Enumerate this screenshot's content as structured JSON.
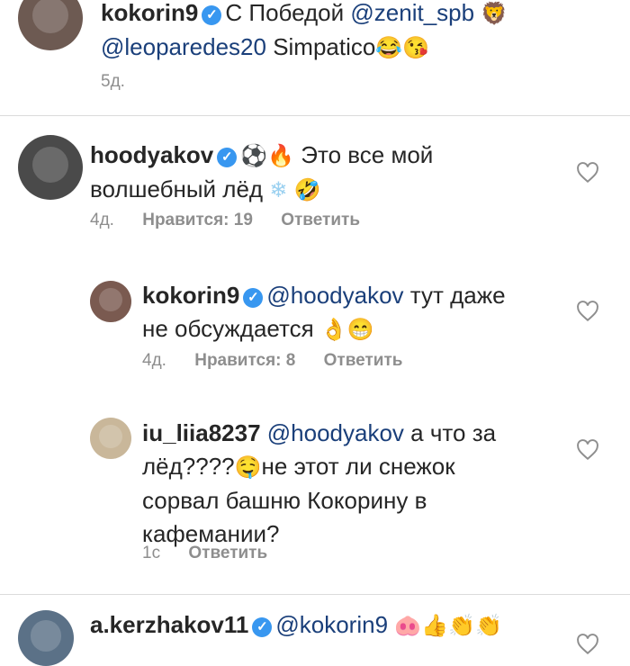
{
  "comments": [
    {
      "username": "kokorin9",
      "line1_pre": "С Победой ",
      "line1_mention": "@zenit_spb",
      "line2_mention": "@leoparedes20",
      "line2_text": " Simpatico",
      "time": "5д.",
      "emoji_a": "🦁",
      "emoji_b": "😂",
      "emoji_c": "😘"
    },
    {
      "username": "hoodyakov",
      "text_a": "Это все мой",
      "text_b": "волшебный лёд",
      "emoji_a": "⚽",
      "emoji_b": "🔥",
      "emoji_c": "❄",
      "emoji_d": "🤣",
      "time": "4д.",
      "likes": "Нравится: 19",
      "reply": "Ответить"
    },
    {
      "username": "kokorin9",
      "mention": "@hoodyakov",
      "text_a": " тут даже",
      "text_b": "не обсуждается",
      "emoji_a": "👌",
      "emoji_b": "😁",
      "time": "4д.",
      "likes": "Нравится: 8",
      "reply": "Ответить"
    },
    {
      "username": "iu_liia8237",
      "mention": "@hoodyakov",
      "text_a": " а что за",
      "text_b1": "лёд????",
      "emoji_a": "🤤",
      "text_b2": "не этот ли снежок",
      "text_c": "сорвал башню Кокорину в",
      "text_d": "кафемании?",
      "time": "1с",
      "reply": "Ответить"
    },
    {
      "username": "a.kerzhakov11",
      "mention": "@kokorin9",
      "emoji_a": "🐽",
      "emoji_b": "👍",
      "emoji_c": "👏",
      "emoji_d": "👏"
    }
  ],
  "icons": {
    "verified": "✓"
  },
  "colors": {
    "verified": "#3897f0",
    "meta": "#8e8e8e",
    "text": "#262626"
  }
}
